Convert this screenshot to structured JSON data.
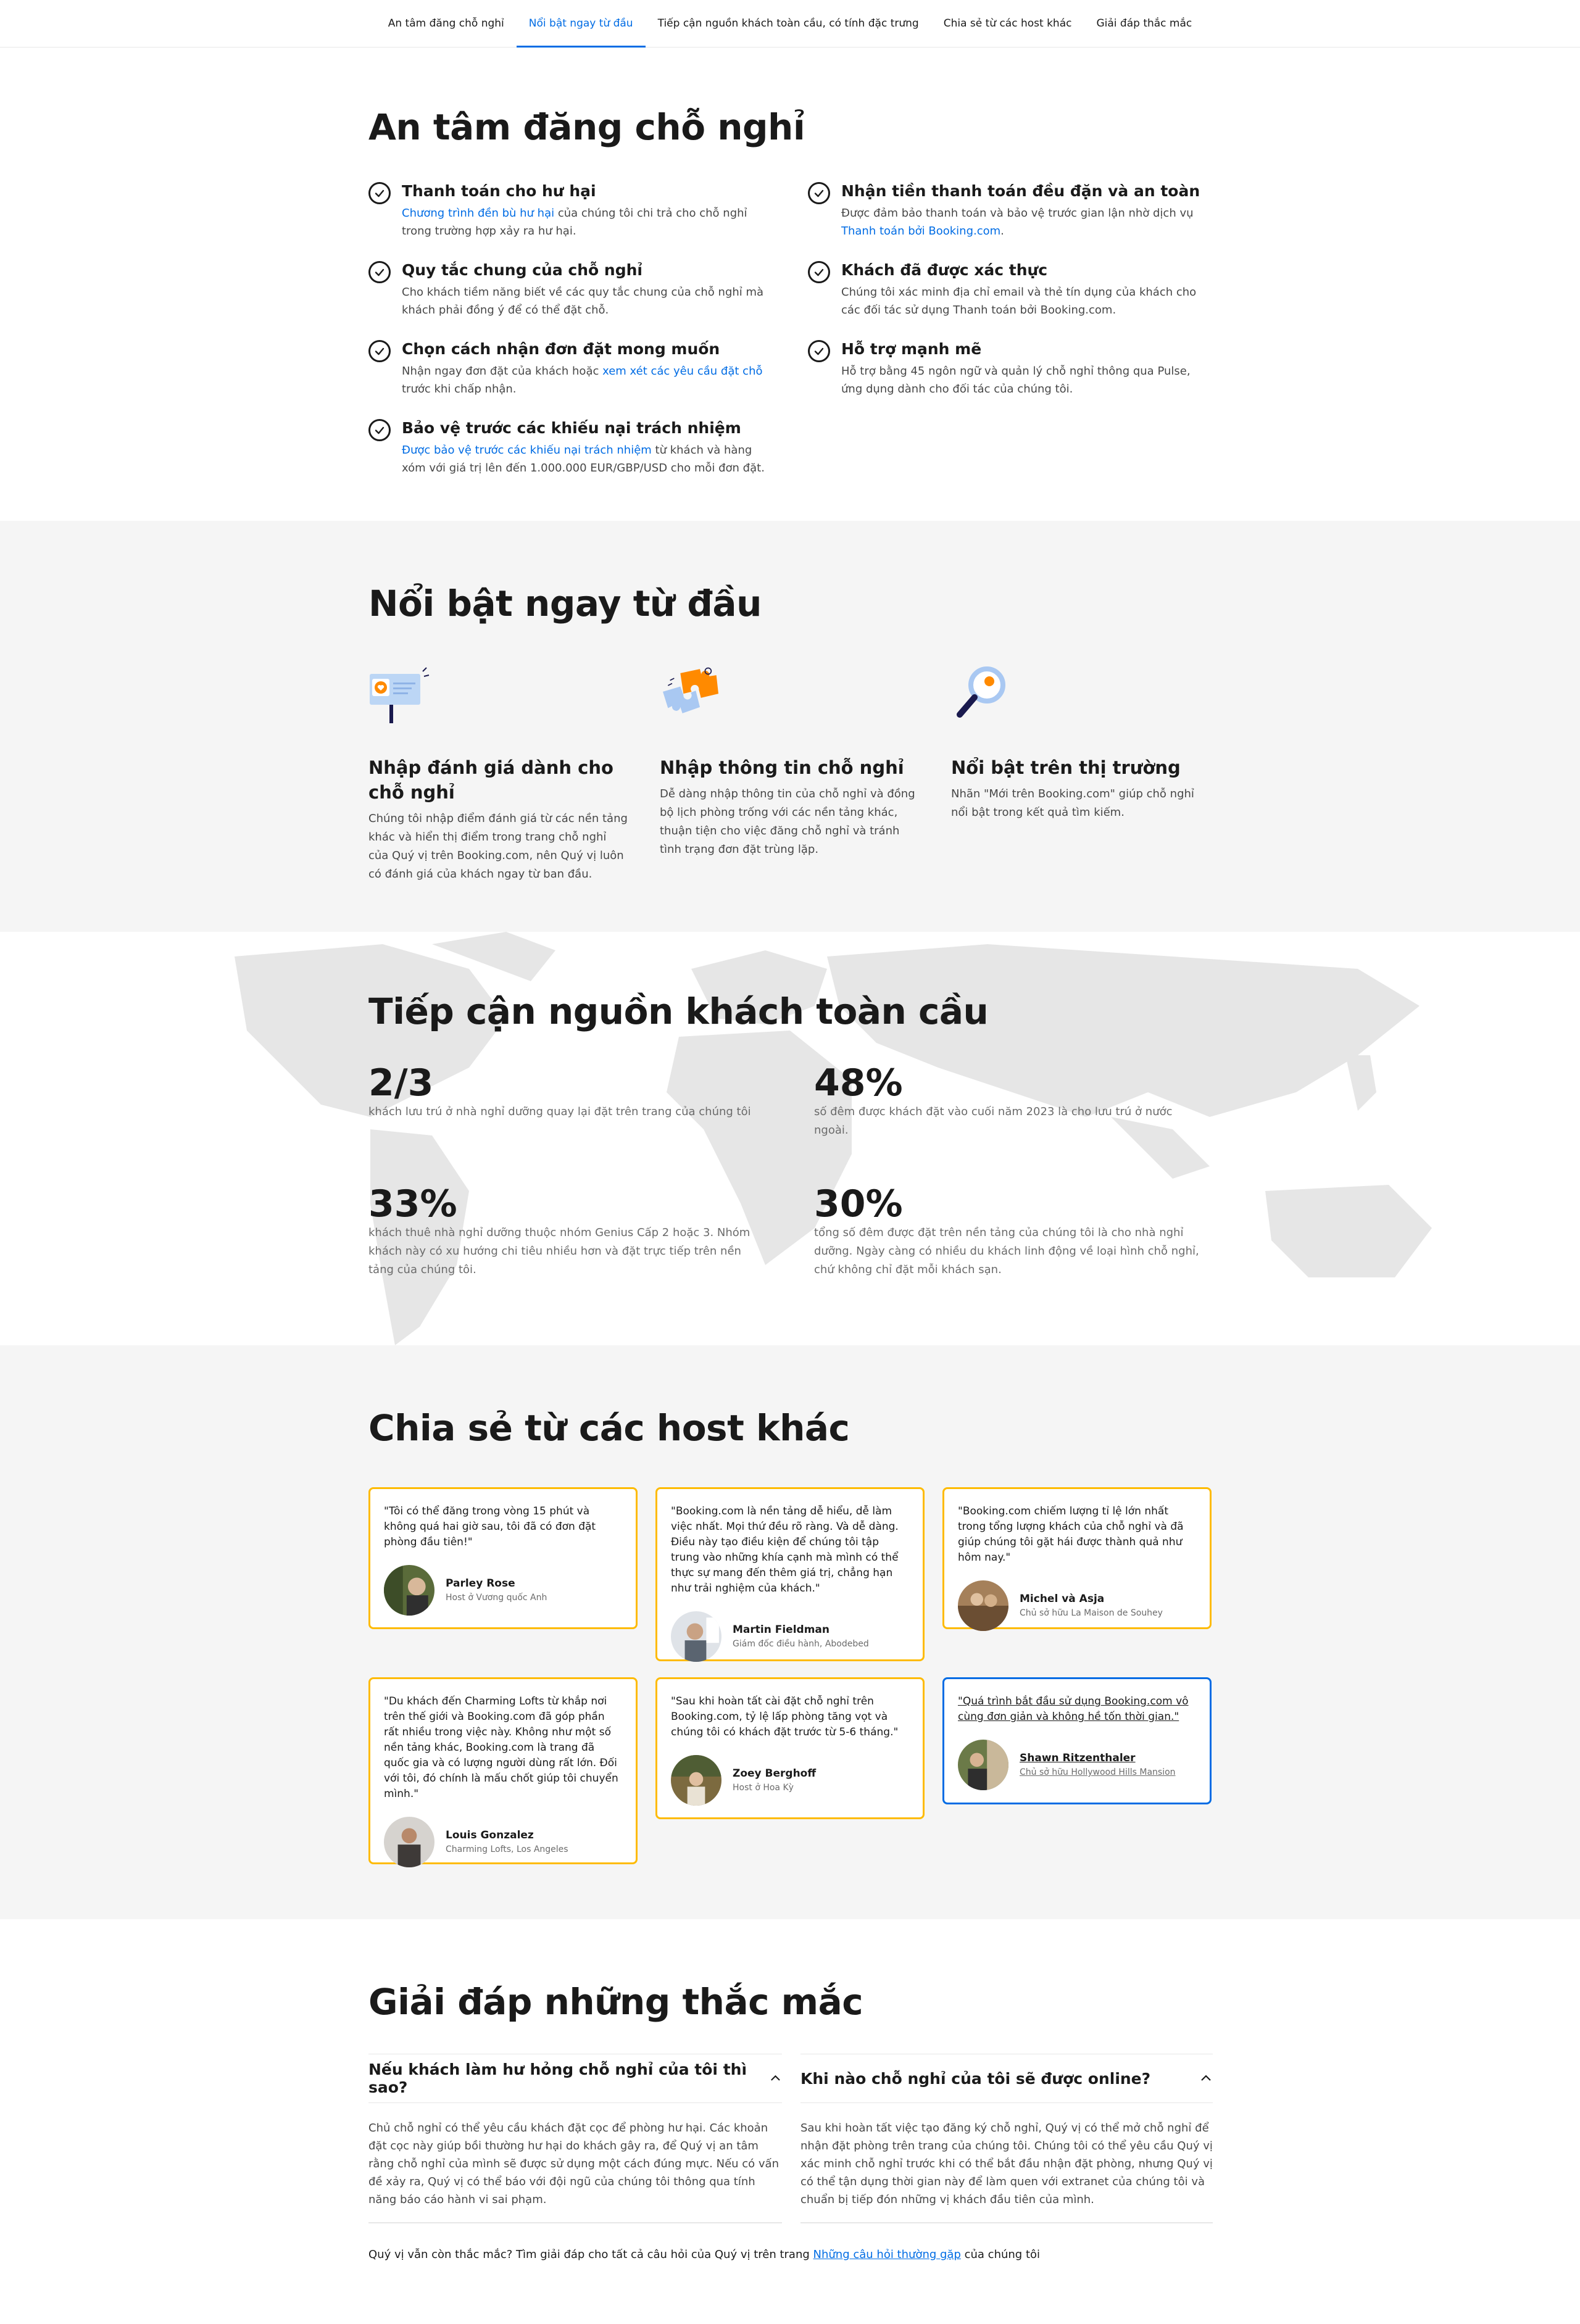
{
  "nav": {
    "items": [
      {
        "label": "An tâm đăng chỗ nghỉ"
      },
      {
        "label": "Nổi bật ngay từ đầu"
      },
      {
        "label": "Tiếp cận nguồn khách toàn cầu, có tính đặc trưng"
      },
      {
        "label": "Chia sẻ từ các host khác"
      },
      {
        "label": "Giải đáp thắc mắc"
      }
    ],
    "active_index": 1
  },
  "peace": {
    "title": "An tâm đăng chỗ nghỉ",
    "left": [
      {
        "title": "Thanh toán cho hư hại",
        "link": "Chương trình đền bù hư hại",
        "text": " của chúng tôi chi trả cho chỗ nghỉ trong trường hợp xảy ra hư hại."
      },
      {
        "title": "Quy tắc chung của chỗ nghỉ",
        "link": "",
        "text": "Cho khách tiềm năng biết về các quy tắc chung của chỗ nghỉ mà khách phải đồng ý để có thể đặt chỗ."
      },
      {
        "title": "Chọn cách nhận đơn đặt mong muốn",
        "pre": "Nhận ngay đơn đặt của khách hoặc ",
        "link": "xem xét các yêu cầu đặt chỗ",
        "text": " trước khi chấp nhận."
      },
      {
        "title": "Bảo vệ trước các khiếu nại trách nhiệm",
        "link": "Được bảo vệ trước các khiếu nại trách nhiệm",
        "text": " từ khách và hàng xóm với giá trị lên đến 1.000.000 EUR/GBP/USD cho mỗi đơn đặt."
      }
    ],
    "right": [
      {
        "title": "Nhận tiền thanh toán đều đặn và an toàn",
        "pre": "Được đảm bảo thanh toán và bảo vệ trước gian lận nhờ dịch vụ ",
        "link": "Thanh toán bởi Booking.com",
        "text": "."
      },
      {
        "title": "Khách đã được xác thực",
        "link": "",
        "text": "Chúng tôi xác minh địa chỉ email và thẻ tín dụng của khách cho các đối tác sử dụng Thanh toán bởi Booking.com."
      },
      {
        "title": "Hỗ trợ mạnh mẽ",
        "link": "",
        "text": "Hỗ trợ bằng 45 ngôn ngữ và quản lý chỗ nghỉ thông qua Pulse, ứng dụng dành cho đối tác của chúng tôi."
      }
    ]
  },
  "standout": {
    "title": "Nổi bật ngay từ đầu",
    "cards": [
      {
        "icon": "review-sign-icon",
        "title": "Nhập đánh giá dành cho chỗ nghỉ",
        "text": "Chúng tôi nhập điểm đánh giá từ các nền tảng khác và hiển thị điểm trong trang chỗ nghỉ của Quý vị trên Booking.com, nên Quý vị luôn có đánh giá của khách ngay từ ban đầu."
      },
      {
        "icon": "puzzle-icon",
        "title": "Nhập thông tin chỗ nghỉ",
        "text": "Dễ dàng nhập thông tin của chỗ nghỉ và đồng bộ lịch phòng trống với các nền tảng khác, thuận tiện cho việc đăng chỗ nghỉ và tránh tình trạng đơn đặt trùng lặp."
      },
      {
        "icon": "magnifier-icon",
        "title": "Nổi bật trên thị trường",
        "text": "Nhãn \"Mới trên Booking.com\" giúp chỗ nghỉ nổi bật trong kết quả tìm kiếm."
      }
    ]
  },
  "global": {
    "title": "Tiếp cận nguồn khách toàn cầu",
    "stats": [
      {
        "value": "2/3",
        "text": "khách lưu trú ở nhà nghỉ dưỡng quay lại đặt trên trang của chúng tôi"
      },
      {
        "value": "48%",
        "text": "số đêm được khách đặt vào cuối năm 2023 là cho lưu trú ở nước ngoài."
      },
      {
        "value": "33%",
        "text": "khách thuê nhà nghỉ dưỡng thuộc nhóm Genius Cấp 2 hoặc 3. Nhóm khách này có xu hướng chi tiêu nhiều hơn và đặt trực tiếp trên nền tảng của chúng tôi."
      },
      {
        "value": "30%",
        "text": "tổng số đêm được đặt trên nền tảng của chúng tôi là cho nhà nghỉ dưỡng. Ngày càng có nhiều du khách linh động về loại hình chỗ nghỉ, chứ không chỉ đặt mỗi khách sạn."
      }
    ]
  },
  "testimonials": {
    "title": "Chia sẻ từ các host khác",
    "items": [
      {
        "quote": "\"Tôi có thể đăng trong vòng 15 phút và không quá hai giờ sau, tôi đã có đơn đặt phòng đầu tiên!\"",
        "name": "Parley Rose",
        "role": "Host ở Vương quốc Anh",
        "avatar_color": "#5a6b3a"
      },
      {
        "quote": "\"Booking.com là nền tảng dễ hiểu, dễ làm việc nhất. Mọi thứ đều rõ ràng. Và dễ dàng. Điều này tạo điều kiện để chúng tôi tập trung vào những khía cạnh mà mình có thể thực sự mang đến thêm giá trị, chẳng hạn như trải nghiệm của khách.\"",
        "name": "Martin Fieldman",
        "role": "Giám đốc điều hành, Abodebed",
        "avatar_color": "#8a8f96"
      },
      {
        "quote": "\"Booking.com chiếm lượng tỉ lệ lớn nhất trong tổng lượng khách của chỗ nghỉ và đã giúp chúng tôi gặt hái được thành quả như hôm nay.\"",
        "name": "Michel và Asja",
        "role": "Chủ sở hữu La Maison de Souhey",
        "avatar_color": "#a5805a"
      },
      {
        "quote": "\"Du khách đến Charming Lofts từ khắp nơi trên thế giới và Booking.com đã góp phần rất nhiều trong việc này. Không như một số nền tảng khác, Booking.com là trang đã quốc gia và có lượng người dùng rất lớn. Đối với tôi, đó chính là mấu chốt giúp tôi chuyển mình.\"",
        "name": "Louis Gonzalez",
        "role": "Charming Lofts, Los Angeles",
        "avatar_color": "#3e3a38"
      },
      {
        "quote": "\"Sau khi hoàn tất cài đặt chỗ nghỉ trên Booking.com, tỷ lệ lấp phòng tăng vọt và chúng tôi có khách đặt trước từ 5-6 tháng.\"",
        "name": "Zoey Berghoff",
        "role": "Host ở Hoa Kỳ",
        "avatar_color": "#7c6a3f"
      },
      {
        "quote": "\"Quá trình bắt đầu sử dụng Booking.com vô cùng đơn giản và không hề tốn thời gian.\"",
        "name": "Shawn Ritzenthaler",
        "role": "Chủ sở hữu Hollywood Hills Mansion",
        "avatar_color": "#6b7a48"
      }
    ]
  },
  "faq": {
    "title": "Giải đáp những thắc mắc",
    "items": [
      {
        "q": "Nếu khách làm hư hỏng chỗ nghỉ của tôi thì sao?",
        "a": "Chủ chỗ nghỉ có thể yêu cầu khách đặt cọc để phòng hư hại. Các khoản đặt cọc này giúp bồi thường hư hại do khách gây ra, để Quý vị an tâm rằng chỗ nghỉ của mình sẽ được sử dụng một cách đúng mực. Nếu có vấn đề xảy ra, Quý vị có thể báo với đội ngũ của chúng tôi thông qua tính năng báo cáo hành vi sai phạm."
      },
      {
        "q": "Khi nào chỗ nghỉ của tôi sẽ được online?",
        "a": "Sau khi hoàn tất việc tạo đăng ký chỗ nghỉ, Quý vị có thể mở chỗ nghỉ để nhận đặt phòng trên trang của chúng tôi. Chúng tôi có thể yêu cầu Quý vị xác minh chỗ nghỉ trước khi có thể bắt đầu nhận đặt phòng, nhưng Quý vị có thể tận dụng thời gian này để làm quen với extranet của chúng tôi và chuẩn bị tiếp đón những vị khách đầu tiên của mình."
      }
    ],
    "footer_pre": "Quý vị vẫn còn thắc mắc? Tìm giải đáp cho tất cả câu hỏi của Quý vị trên trang ",
    "footer_link": "Những câu hỏi thường gặp",
    "footer_post": " của chúng tôi"
  },
  "colors": {
    "accent": "#006ce4",
    "card_border": "#febb02",
    "map": "#e6e6e6",
    "section_bg": "#f5f5f5"
  }
}
